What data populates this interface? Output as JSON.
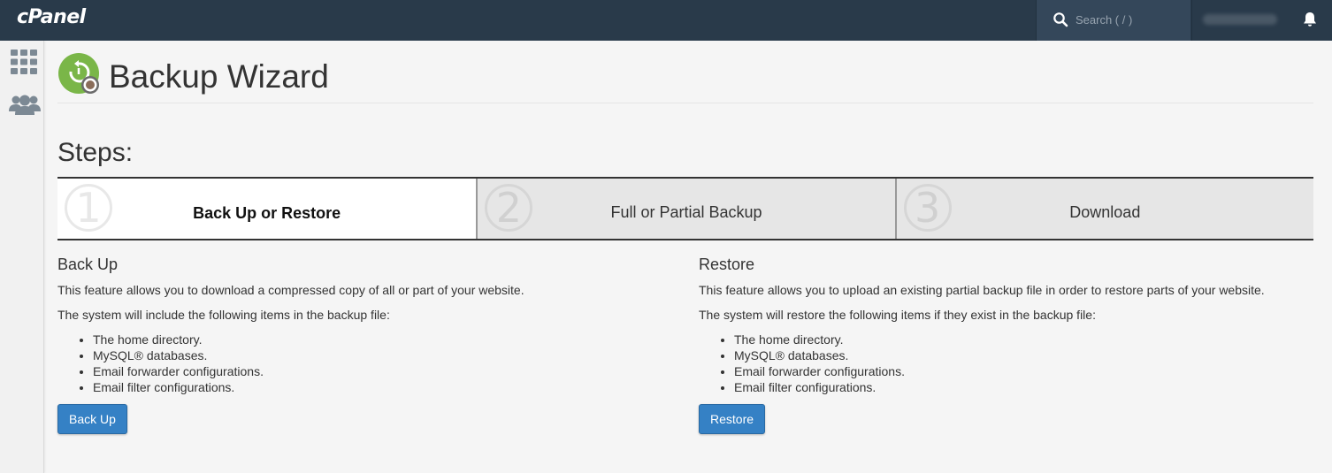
{
  "topbar": {
    "logo": "cPanel",
    "search_placeholder": "Search ( / )",
    "bell_icon": "bell-icon"
  },
  "sidebar": {
    "items": [
      {
        "icon": "apps-grid-icon"
      },
      {
        "icon": "users-icon"
      }
    ]
  },
  "page": {
    "title": "Backup Wizard",
    "icon": "backup-wizard-icon",
    "steps_title": "Steps:",
    "steps": [
      {
        "number": "1",
        "label": "Back Up or Restore",
        "active": true
      },
      {
        "number": "2",
        "label": "Full or Partial Backup",
        "active": false
      },
      {
        "number": "3",
        "label": "Download",
        "active": false
      }
    ]
  },
  "backup": {
    "heading": "Back Up",
    "desc1": "This feature allows you to download a compressed copy of all or part of your website.",
    "desc2": "The system will include the following items in the backup file:",
    "items": [
      "The home directory.",
      "MySQL® databases.",
      "Email forwarder configurations.",
      "Email filter configurations."
    ],
    "button": "Back Up"
  },
  "restore": {
    "heading": "Restore",
    "desc1": "This feature allows you to upload an existing partial backup file in order to restore parts of your website.",
    "desc2": "The system will restore the following items if they exist in the backup file:",
    "items": [
      "The home directory.",
      "MySQL® databases.",
      "Email forwarder configurations.",
      "Email filter configurations."
    ],
    "button": "Restore"
  },
  "colors": {
    "topbar": "#293a4a",
    "button": "#3581c5",
    "icon_green": "#7ab648"
  }
}
